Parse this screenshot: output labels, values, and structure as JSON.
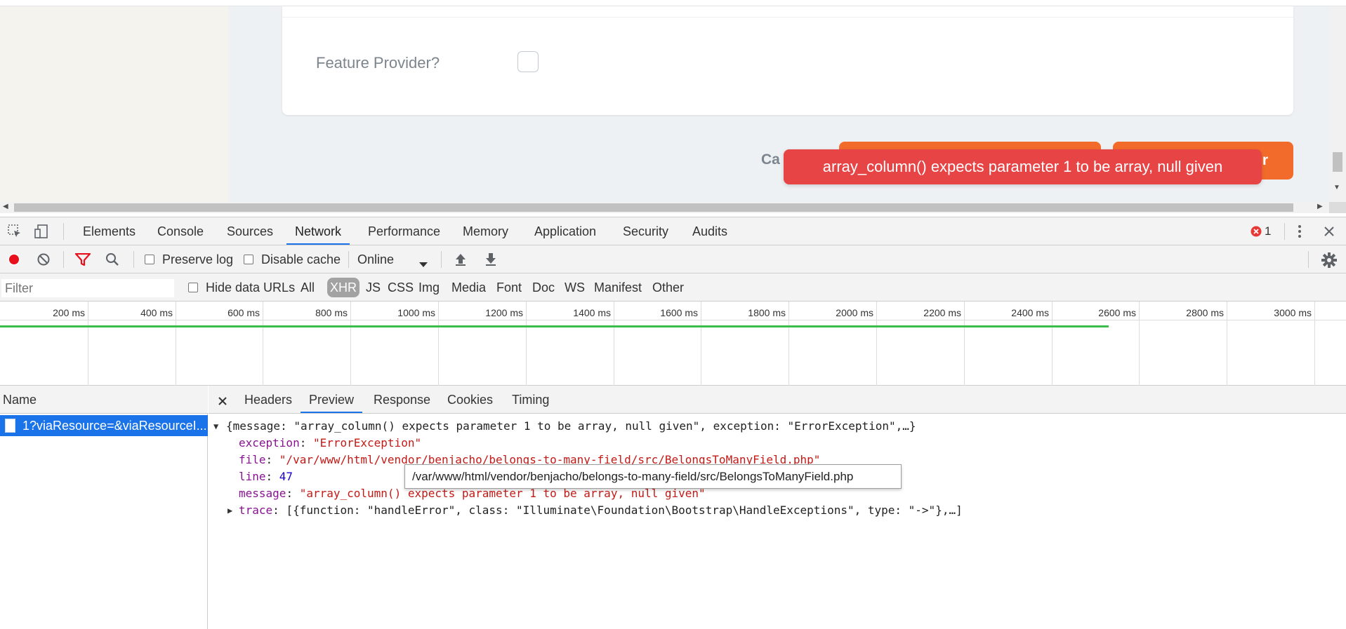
{
  "page": {
    "feature_label": "Feature Provider?",
    "cancel_label": "Ca",
    "create_button_label": "r",
    "toast_message": "array_column() expects parameter 1 to be array, null given"
  },
  "devtools": {
    "tabs": [
      "Elements",
      "Console",
      "Sources",
      "Network",
      "Performance",
      "Memory",
      "Application",
      "Security",
      "Audits"
    ],
    "active_tab": "Network",
    "error_count": "1",
    "toolbar": {
      "preserve_log": "Preserve log",
      "disable_cache": "Disable cache",
      "throttle": "Online"
    },
    "filter": {
      "placeholder": "Filter",
      "hide_data_urls": "Hide data URLs",
      "types": [
        "All",
        "XHR",
        "JS",
        "CSS",
        "Img",
        "Media",
        "Font",
        "Doc",
        "WS",
        "Manifest",
        "Other"
      ],
      "active_type": "XHR"
    },
    "timeline": {
      "ticks": [
        "200 ms",
        "400 ms",
        "600 ms",
        "800 ms",
        "1000 ms",
        "1200 ms",
        "1400 ms",
        "1600 ms",
        "1800 ms",
        "2000 ms",
        "2200 ms",
        "2400 ms",
        "2600 ms",
        "2800 ms",
        "3000 ms"
      ],
      "request_end_ms": 2530
    },
    "requests": {
      "header": "Name",
      "items": [
        "1?viaResource=&viaResourceI..."
      ]
    },
    "detail": {
      "tabs": [
        "Headers",
        "Preview",
        "Response",
        "Cookies",
        "Timing"
      ],
      "active_tab": "Preview",
      "preview": {
        "summary": "{message: \"array_column() expects parameter 1 to be array, null given\", exception: \"ErrorException\",…}",
        "exception_key": "exception",
        "exception_value": "\"ErrorException\"",
        "file_key": "file",
        "file_value": "\"/var/www/html/vendor/benjacho/belongs-to-many-field/src/BelongsToManyField.php\"",
        "line_key": "line",
        "line_value": "47",
        "message_key": "message",
        "message_value": "\"array_column() expects parameter 1 to be array, null given\"",
        "trace_key": "trace",
        "trace_value": "[{function: \"handleError\", class: \"Illuminate\\Foundation\\Bootstrap\\HandleExceptions\", type: \"->\"},…]"
      },
      "tooltip": "/var/www/html/vendor/benjacho/belongs-to-many-field/src/BelongsToManyField.php"
    }
  }
}
